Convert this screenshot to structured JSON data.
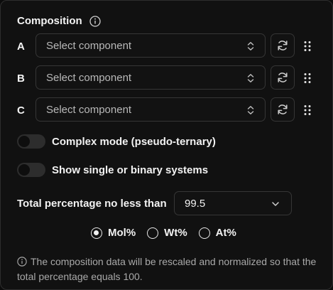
{
  "composition": {
    "title": "Composition",
    "rows": [
      {
        "letter": "A",
        "placeholder": "Select component"
      },
      {
        "letter": "B",
        "placeholder": "Select component"
      },
      {
        "letter": "C",
        "placeholder": "Select component"
      }
    ]
  },
  "toggles": [
    {
      "label": "Complex mode (pseudo-ternary)",
      "on": false
    },
    {
      "label": "Show single or binary systems",
      "on": false
    }
  ],
  "total": {
    "label": "Total percentage no less than",
    "value": "99.5"
  },
  "units": {
    "options": [
      "Mol%",
      "Wt%",
      "At%"
    ],
    "selected": "Mol%"
  },
  "note": "The composition data will be rescaled and normalized so that the total percentage equals 100.",
  "colors": {
    "background": "#111111",
    "border": "#363636",
    "toggle_off": "#2d2d2d",
    "text": "#f2f2f2",
    "muted": "#a9a9a9"
  },
  "icons": {
    "info": "info-icon",
    "refresh": "refresh-icon",
    "drag": "drag-handle-icon",
    "select": "chevron-updown-icon",
    "dropdown": "chevron-down-icon"
  }
}
